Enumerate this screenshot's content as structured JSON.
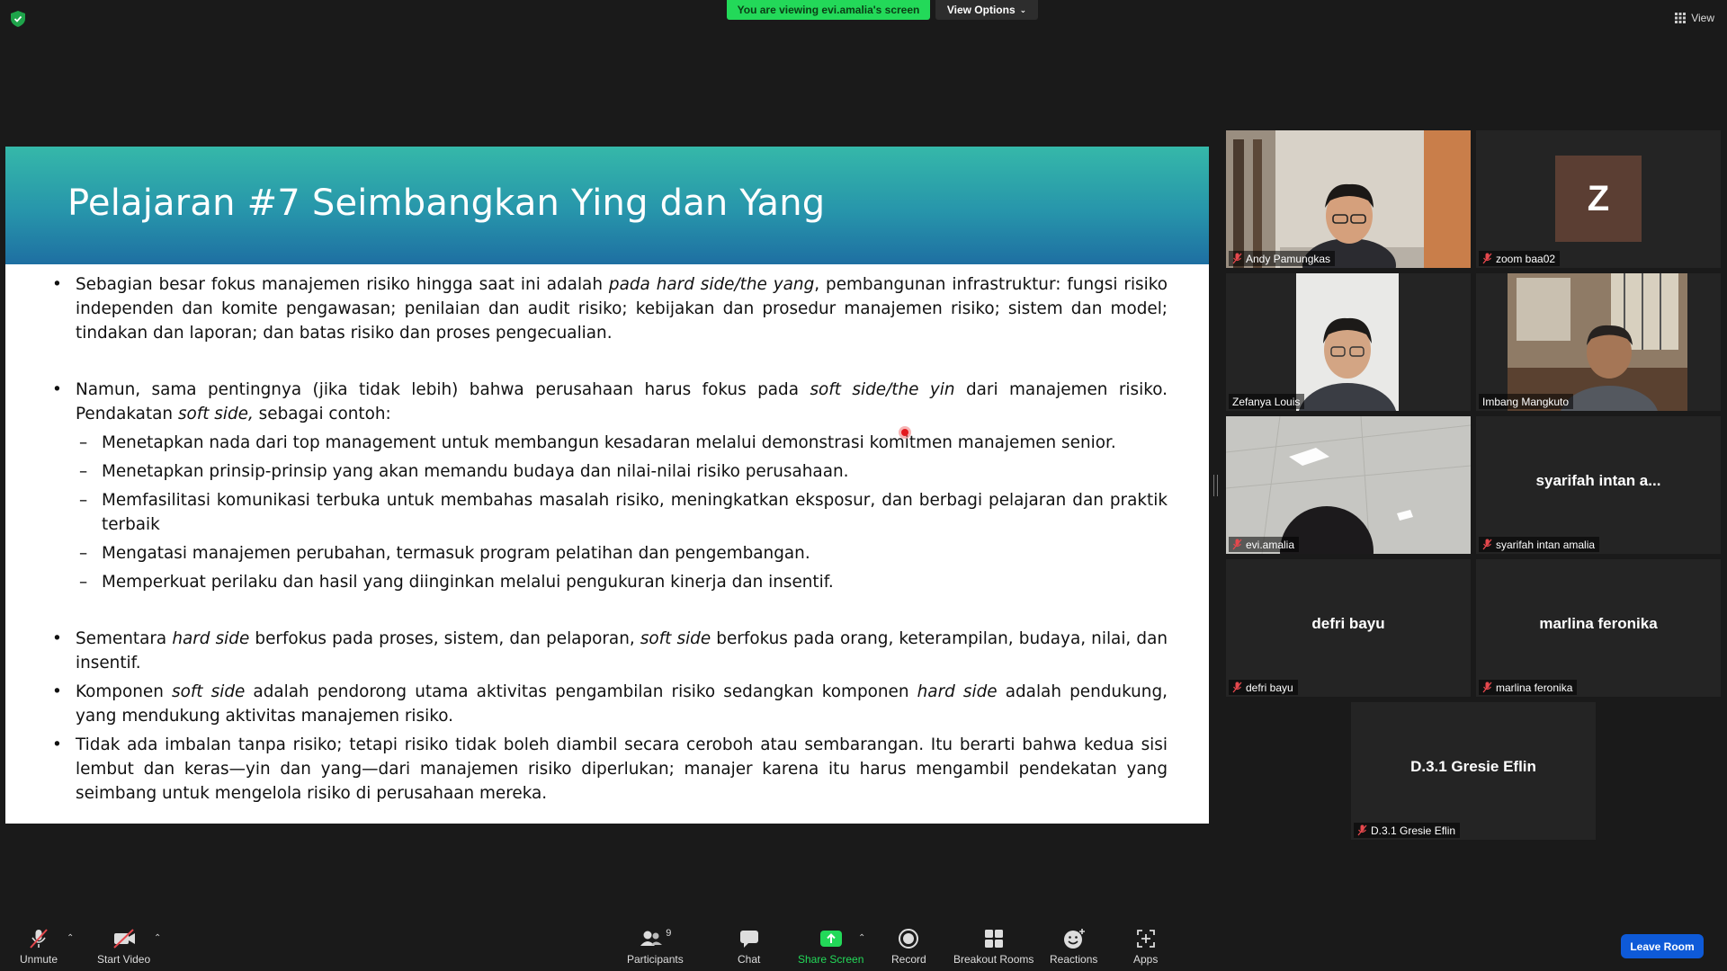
{
  "topbar": {
    "banner": "You are viewing evi.amalia's screen",
    "view_options": "View Options",
    "view": "View"
  },
  "slide": {
    "title": "Pelajaran #7 Seimbangkan Ying dan Yang",
    "b1": {
      "p1": "Sebagian besar fokus manajemen risiko hingga saat ini adalah ",
      "i1": "pada hard side/the yang",
      "p2": ", pembangunan infrastruktur: fungsi risiko independen dan komite pengawasan; penilaian dan audit risiko; kebijakan dan prosedur manajemen risiko; sistem dan model; tindakan dan laporan; dan batas risiko dan proses pengecualian."
    },
    "b2": {
      "p1": "Namun, sama pentingnya (jika tidak lebih) bahwa perusahaan harus fokus pada ",
      "i1": "soft side/the yin",
      "p2": " dari manajemen risiko. Pendakatan ",
      "i2": "soft side,",
      "p3": " sebagai contoh:"
    },
    "subs": [
      "Menetapkan nada dari top management untuk membangun kesadaran melalui demonstrasi komitmen manajemen senior.",
      "Menetapkan prinsip-prinsip yang akan memandu budaya dan nilai-nilai risiko perusahaan.",
      "Memfasilitasi komunikasi terbuka untuk membahas masalah risiko, meningkatkan eksposur, dan berbagi pelajaran dan praktik terbaik",
      "Mengatasi manajemen perubahan, termasuk program pelatihan dan pengembangan.",
      "Memperkuat perilaku dan hasil yang diinginkan melalui pengukuran kinerja dan insentif."
    ],
    "b3": {
      "p1": "Sementara ",
      "i1": "hard side",
      "p2": " berfokus pada proses, sistem, dan pelaporan, ",
      "i2": "soft side",
      "p3": " berfokus pada orang, keterampilan, budaya, nilai, dan insentif."
    },
    "b4": {
      "p1": "Komponen ",
      "i1": "soft side",
      "p2": " adalah pendorong utama aktivitas pengambilan risiko sedangkan komponen ",
      "i2": "hard side",
      "p3": " adalah pendukung, yang mendukung aktivitas manajemen risiko."
    },
    "b5": "Tidak ada imbalan tanpa risiko; tetapi risiko tidak boleh diambil secara ceroboh atau sembarangan. Itu berarti bahwa kedua sisi lembut dan keras—yin dan yang—dari manajemen risiko diperlukan; manajer karena itu harus mengambil pendekatan yang seimbang untuk mengelola risiko di perusahaan mereka."
  },
  "participants": [
    {
      "name": "Andy Pamungkas",
      "type": "video"
    },
    {
      "name": "zoom baa02",
      "type": "avatar",
      "initial": "Z"
    },
    {
      "name": "Zefanya Louis",
      "type": "video",
      "active": true
    },
    {
      "name": "Imbang Mangkuto",
      "type": "video"
    },
    {
      "name": "evi.amalia",
      "type": "video"
    },
    {
      "name": "syarifah intan amalia",
      "type": "name",
      "display": "syarifah intan a..."
    },
    {
      "name": "defri bayu",
      "type": "name",
      "display": "defri bayu"
    },
    {
      "name": "marlina feronika",
      "type": "name",
      "display": "marlina feronika"
    },
    {
      "name": "D.3.1 Gresie Eflin",
      "type": "name",
      "display": "D.3.1 Gresie Eflin"
    }
  ],
  "toolbar": {
    "unmute": "Unmute",
    "start_video": "Start Video",
    "participants": "Participants",
    "participants_count": "9",
    "chat": "Chat",
    "share_screen": "Share Screen",
    "record": "Record",
    "breakout_rooms": "Breakout Rooms",
    "reactions": "Reactions",
    "apps": "Apps",
    "leave_room": "Leave Room"
  },
  "colors": {
    "banner": "#23d959",
    "share_screen": "#23d959",
    "leave_button": "#0e5ad8",
    "active_speaker_border": "#d9ec88",
    "muted_icon": "#e5484d"
  }
}
